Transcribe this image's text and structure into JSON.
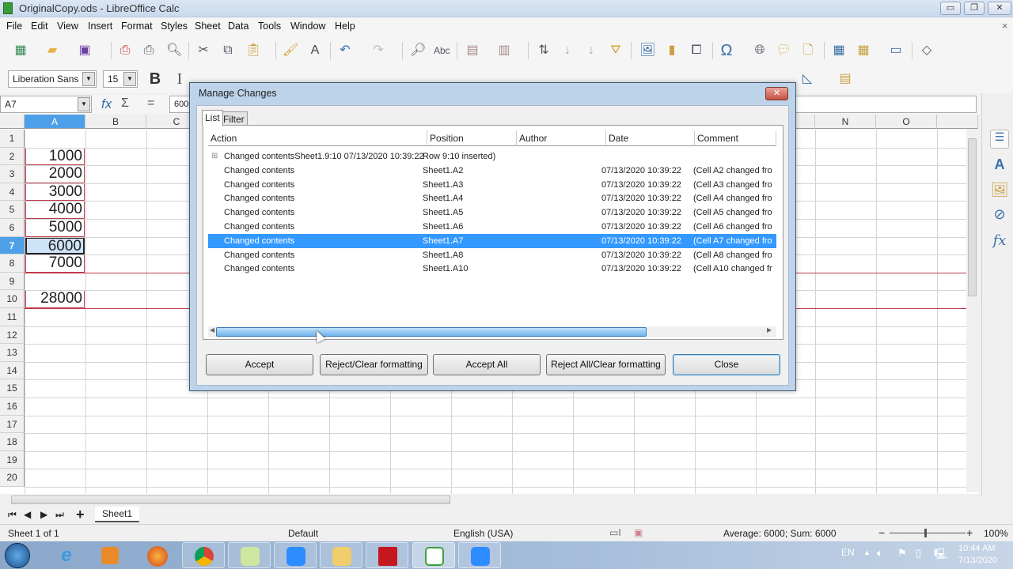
{
  "window": {
    "title": "OriginalCopy.ods - LibreOffice Calc",
    "minimize_icon": "minimize-icon",
    "restore_icon": "restore-icon",
    "close_icon": "close-icon"
  },
  "menubar": {
    "items": [
      "File",
      "Edit",
      "View",
      "Insert",
      "Format",
      "Styles",
      "Sheet",
      "Data",
      "Tools",
      "Window",
      "Help"
    ],
    "close_doc": "×"
  },
  "toolbar": {
    "font_name": "Liberation Sans",
    "font_size": "15",
    "bold": "B",
    "italic": "I"
  },
  "formula_bar": {
    "name_box": "A7",
    "fx": "fx",
    "sigma": "Σ",
    "equals": "=",
    "content": "6000"
  },
  "sheet": {
    "columns": [
      "A",
      "B",
      "C",
      "N",
      "O"
    ],
    "selected_column": "A",
    "rows": [
      "1",
      "2",
      "3",
      "4",
      "5",
      "6",
      "7",
      "8",
      "9",
      "10",
      "11",
      "12",
      "13",
      "14",
      "15",
      "16",
      "17",
      "18",
      "19",
      "20"
    ],
    "selected_row": "7",
    "cells": [
      {
        "row": "2",
        "value": "1000"
      },
      {
        "row": "3",
        "value": "2000"
      },
      {
        "row": "4",
        "value": "3000"
      },
      {
        "row": "5",
        "value": "4000"
      },
      {
        "row": "6",
        "value": "5000"
      },
      {
        "row": "7",
        "value": "6000"
      },
      {
        "row": "8",
        "value": "7000"
      },
      {
        "row": "10",
        "value": "28000"
      }
    ]
  },
  "tabs": {
    "sheet_tab": "Sheet1",
    "add": "+"
  },
  "statusbar": {
    "sheet_info": "Sheet 1 of 1",
    "page_style": "Default",
    "language": "English (USA)",
    "summary": "Average: 6000; Sum: 6000",
    "zoom": "100%",
    "zoom_minus": "−",
    "zoom_plus": "+"
  },
  "dialog": {
    "title": "Manage Changes",
    "tabs": [
      "List",
      "Filter"
    ],
    "active_tab": "List",
    "columns": [
      "Action",
      "Position",
      "Author",
      "Date",
      "Comment"
    ],
    "rows": [
      {
        "action": "Changed contentsSheet1.9:10 07/13/2020 10:39:22",
        "position": "Row 9:10 inserted)",
        "author": "",
        "date": "",
        "comment": "",
        "expandable": true
      },
      {
        "action": "Changed contents",
        "position": "Sheet1.A2",
        "author": "",
        "date": "07/13/2020 10:39:22",
        "comment": "(Cell A2 changed fro"
      },
      {
        "action": "Changed contents",
        "position": "Sheet1.A3",
        "author": "",
        "date": "07/13/2020 10:39:22",
        "comment": "(Cell A3 changed fro"
      },
      {
        "action": "Changed contents",
        "position": "Sheet1.A4",
        "author": "",
        "date": "07/13/2020 10:39:22",
        "comment": "(Cell A4 changed fro"
      },
      {
        "action": "Changed contents",
        "position": "Sheet1.A5",
        "author": "",
        "date": "07/13/2020 10:39:22",
        "comment": "(Cell A5 changed fro"
      },
      {
        "action": "Changed contents",
        "position": "Sheet1.A6",
        "author": "",
        "date": "07/13/2020 10:39:22",
        "comment": "(Cell A6 changed fro"
      },
      {
        "action": "Changed contents",
        "position": "Sheet1.A7",
        "author": "",
        "date": "07/13/2020 10:39:22",
        "comment": "(Cell A7 changed fro",
        "selected": true
      },
      {
        "action": "Changed contents",
        "position": "Sheet1.A8",
        "author": "",
        "date": "07/13/2020 10:39:22",
        "comment": "(Cell A8 changed fro"
      },
      {
        "action": "Changed contents",
        "position": "Sheet1.A10",
        "author": "",
        "date": "07/13/2020 10:39:22",
        "comment": "(Cell A10 changed fr"
      }
    ],
    "buttons": {
      "accept": "Accept",
      "reject": "Reject/Clear formatting",
      "accept_all": "Accept All",
      "reject_all": "Reject All/Clear formatting",
      "close": "Close"
    }
  },
  "taskbar": {
    "lang": "EN",
    "time": "10:44 AM",
    "date": "7/13/2020"
  },
  "colors": {
    "selection": "#3399ff",
    "header_selected": "#4da0e8",
    "change_mark": "#c0394a"
  }
}
